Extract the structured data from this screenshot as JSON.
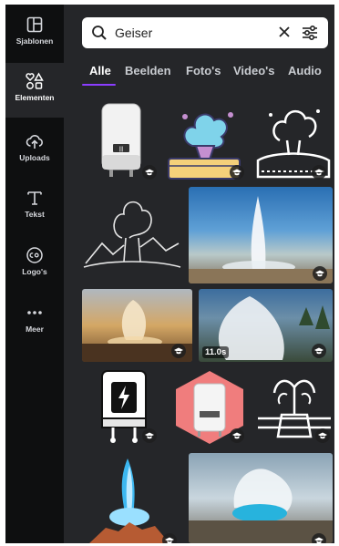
{
  "rail": {
    "items": [
      {
        "label": "Sjablonen",
        "icon": "templates-icon"
      },
      {
        "label": "Elementen",
        "icon": "elements-icon"
      },
      {
        "label": "Uploads",
        "icon": "upload-cloud-icon"
      },
      {
        "label": "Tekst",
        "icon": "text-icon"
      },
      {
        "label": "Logo's",
        "icon": "logo-icon"
      },
      {
        "label": "Meer",
        "icon": "more-dots-icon"
      }
    ],
    "active": "Elementen"
  },
  "search": {
    "value": "Geiser",
    "placeholder": ""
  },
  "tabs": [
    "Alle",
    "Beelden",
    "Foto's",
    "Video's",
    "Audio"
  ],
  "active_tab": "Alle",
  "results": {
    "video_duration": "11.0s"
  },
  "colors": {
    "accent": "#8b3dff",
    "rail_bg": "#0e0f10",
    "panel_bg": "#252629"
  }
}
